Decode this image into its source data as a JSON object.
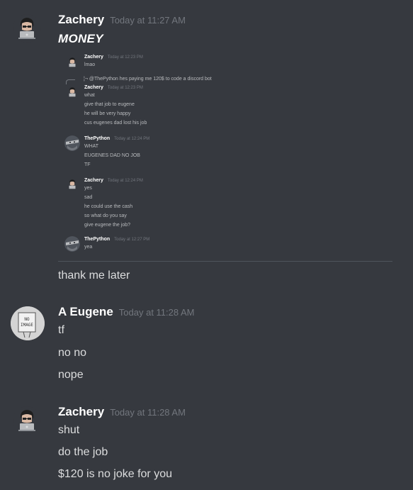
{
  "messages": [
    {
      "username": "Zachery",
      "timestamp": "Today at 11:27 AM",
      "avatar_icon": "anime-avatar-icon",
      "title": "MONEY",
      "embed": {
        "messages": [
          {
            "username": "Zachery",
            "timestamp": "Today at 12:23 PM",
            "lines": [
              "lmao"
            ]
          },
          {
            "reply": "@ThePython hes paying me 120$ to code a discord bot",
            "username": "Zachery",
            "timestamp": "Today at 12:23 PM",
            "lines": [
              "what",
              "give that job to eugene",
              "he will be very happy",
              "cus eugenes dad lost his job"
            ]
          },
          {
            "username": "ThePython",
            "timestamp": "Today at 12:24 PM",
            "lines": [
              "WHAT",
              "EUGENES DAD NO JOB",
              "TF"
            ]
          },
          {
            "username": "Zachery",
            "timestamp": "Today at 12:24 PM",
            "lines": [
              "yes",
              "sad",
              "he could use the cash",
              "so what do you say",
              "give eugene the job?"
            ]
          },
          {
            "username": "ThePython",
            "timestamp": "Today at 12:27 PM",
            "lines": [
              "yea"
            ]
          }
        ]
      },
      "after": "thank me later"
    },
    {
      "username": "A Eugene",
      "timestamp": "Today at 11:28 AM",
      "avatar_icon": "no-image-avatar-icon",
      "avatar_text": [
        "NO",
        "IMAGE"
      ],
      "lines": [
        "tf",
        "no no",
        "nope"
      ]
    },
    {
      "username": "Zachery",
      "timestamp": "Today at 11:28 AM",
      "avatar_icon": "anime-avatar-icon",
      "lines": [
        "shut",
        "do the job",
        "$120 is no joke for you"
      ]
    }
  ],
  "colors": {
    "background": "#36393f",
    "username": "#ffffff",
    "text": "#dcddde",
    "timestamp": "#72767d"
  }
}
